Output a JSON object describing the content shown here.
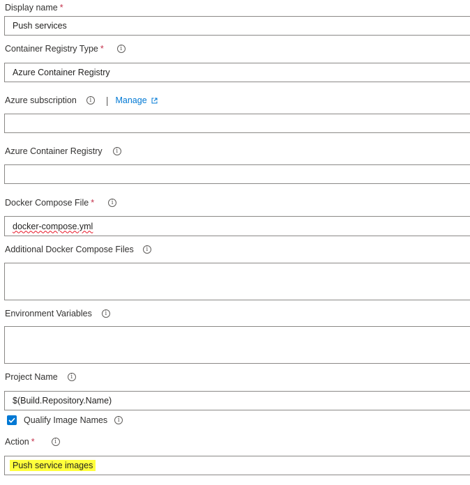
{
  "form": {
    "display_name": {
      "label": "Display name",
      "required": "*",
      "value": "Push services"
    },
    "registry_type": {
      "label": "Container Registry Type",
      "required": "*",
      "info": "i",
      "value": "Azure Container Registry"
    },
    "subscription": {
      "label": "Azure subscription",
      "info": "i",
      "separator": "|",
      "link": "Manage",
      "value": ""
    },
    "acr": {
      "label": "Azure Container Registry",
      "info": "i",
      "value": ""
    },
    "compose_file": {
      "label": "Docker Compose File",
      "required": "*",
      "info": "i",
      "value": "docker-compose.yml"
    },
    "additional_files": {
      "label": "Additional Docker Compose Files",
      "info": "i",
      "value": ""
    },
    "env_vars": {
      "label": "Environment Variables",
      "info": "i",
      "value": ""
    },
    "project_name": {
      "label": "Project Name",
      "info": "i",
      "value": "$(Build.Repository.Name)"
    },
    "qualify": {
      "label": "Qualify Image Names",
      "info": "i",
      "checked": true
    },
    "action": {
      "label": "Action",
      "required": "*",
      "info": "i",
      "value": "Push service images"
    }
  },
  "icons": {
    "info": "info-icon",
    "external": "external-link-icon",
    "check": "checkmark-icon"
  },
  "colors": {
    "link": "#0078d4",
    "required": "#c4314b",
    "checkbox": "#0078d4",
    "highlight": "#ffff3c",
    "border": "#8a8886"
  }
}
